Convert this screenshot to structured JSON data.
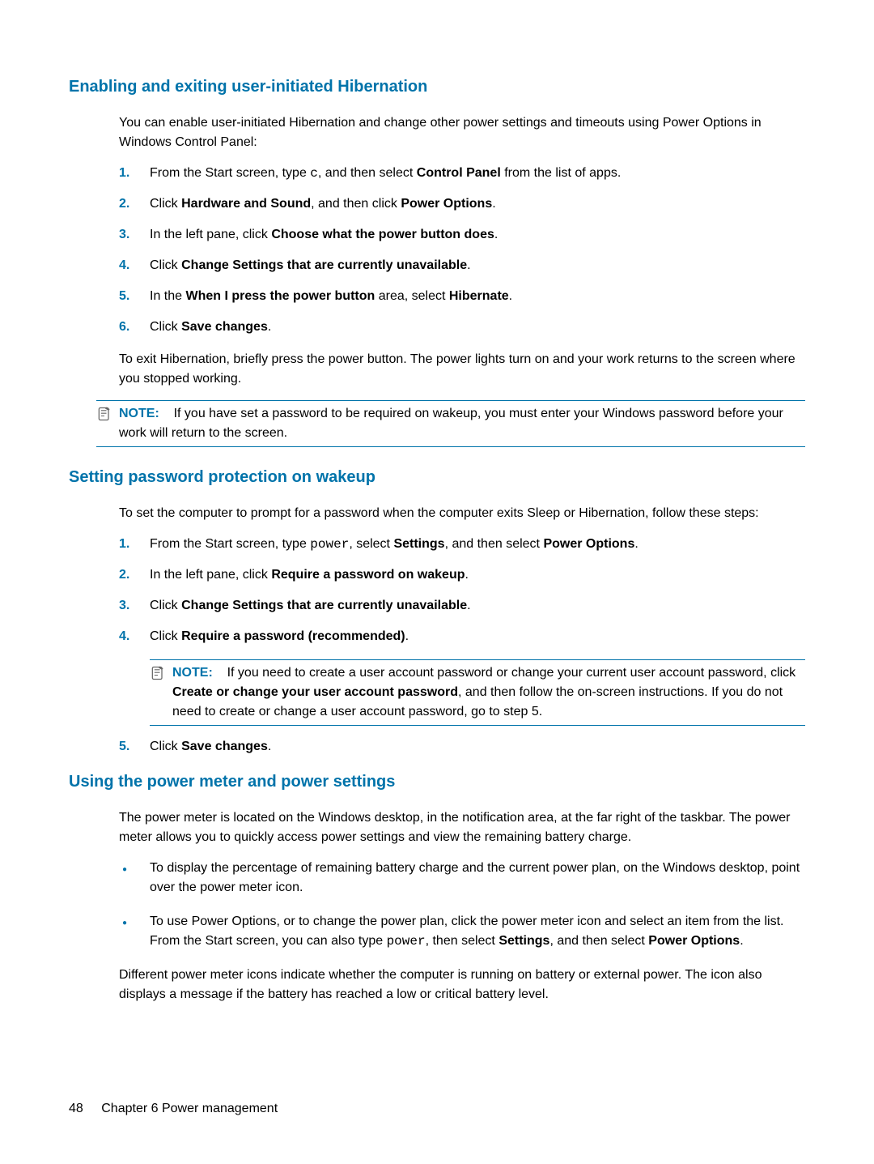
{
  "sections": {
    "s1": {
      "heading": "Enabling and exiting user-initiated Hibernation",
      "intro": "You can enable user-initiated Hibernation and change other power settings and timeouts using Power Options in Windows Control Panel:",
      "steps": [
        {
          "num": "1.",
          "pre": "From the Start screen, type ",
          "code": "c",
          "mid": ", and then select ",
          "b1": "Control Panel",
          "post": " from the list of apps."
        },
        {
          "num": "2.",
          "pre": "Click ",
          "b1": "Hardware and Sound",
          "mid": ", and then click ",
          "b2": "Power Options",
          "post": "."
        },
        {
          "num": "3.",
          "pre": "In the left pane, click ",
          "b1": "Choose what the power button does",
          "post": "."
        },
        {
          "num": "4.",
          "pre": "Click ",
          "b1": "Change Settings that are currently unavailable",
          "post": "."
        },
        {
          "num": "5.",
          "pre": "In the ",
          "b1": "When I press the power button",
          "mid": " area, select ",
          "b2": "Hibernate",
          "post": "."
        },
        {
          "num": "6.",
          "pre": "Click ",
          "b1": "Save changes",
          "post": "."
        }
      ],
      "after": "To exit Hibernation, briefly press the power button. The power lights turn on and your work returns to the screen where you stopped working.",
      "note_label": "NOTE:",
      "note_text": "If you have set a password to be required on wakeup, you must enter your Windows password before your work will return to the screen."
    },
    "s2": {
      "heading": "Setting password protection on wakeup",
      "intro": "To set the computer to prompt for a password when the computer exits Sleep or Hibernation, follow these steps:",
      "steps": [
        {
          "num": "1.",
          "pre": "From the Start screen, type ",
          "code": "power",
          "mid": ", select ",
          "b1": "Settings",
          "mid2": ", and then select ",
          "b2": "Power Options",
          "post": "."
        },
        {
          "num": "2.",
          "pre": "In the left pane, click ",
          "b1": "Require a password on wakeup",
          "post": "."
        },
        {
          "num": "3.",
          "pre": "Click ",
          "b1": "Change Settings that are currently unavailable",
          "post": "."
        },
        {
          "num": "4.",
          "pre": "Click ",
          "b1": "Require a password (recommended)",
          "post": "."
        }
      ],
      "note_label": "NOTE:",
      "note_pre": "If you need to create a user account password or change your current user account password, click ",
      "note_b": "Create or change your user account password",
      "note_post": ", and then follow the on-screen instructions. If you do not need to create or change a user account password, go to step 5.",
      "step5": {
        "num": "5.",
        "pre": "Click ",
        "b1": "Save changes",
        "post": "."
      }
    },
    "s3": {
      "heading": "Using the power meter and power settings",
      "intro": "The power meter is located on the Windows desktop, in the notification area, at the far right of the taskbar. The power meter allows you to quickly access power settings and view the remaining battery charge.",
      "bullets": [
        {
          "text": "To display the percentage of remaining battery charge and the current power plan, on the Windows desktop, point over the power meter icon."
        },
        {
          "pre": "To use Power Options, or to change the power plan, click the power meter icon and select an item from the list. From the Start screen, you can also type ",
          "code": "power",
          "mid": ", then select ",
          "b1": "Settings",
          "mid2": ", and then select ",
          "b2": "Power Options",
          "post": "."
        }
      ],
      "after": "Different power meter icons indicate whether the computer is running on battery or external power. The icon also displays a message if the battery has reached a low or critical battery level."
    }
  },
  "footer": {
    "page": "48",
    "chapter": "Chapter 6   Power management"
  }
}
